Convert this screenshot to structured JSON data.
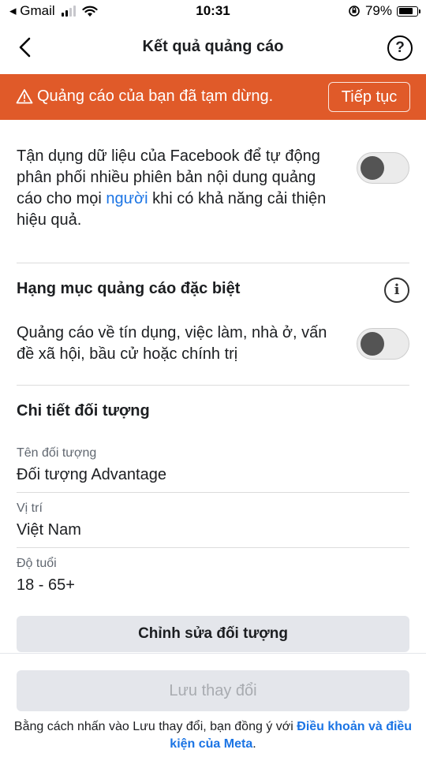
{
  "status_bar": {
    "carrier": "◂ Gmail",
    "time": "10:31",
    "battery": "79%"
  },
  "header": {
    "title": "Kết quả quảng cáo",
    "help_label": "?"
  },
  "banner": {
    "message": "Quảng cáo của bạn đã tạm dừng.",
    "action_label": "Tiếp tục",
    "color": "#e05a29"
  },
  "dynamic_creative": {
    "text_before_link": "Tận dụng dữ liệu của Facebook để tự động phân phối nhiều phiên bản nội dung quảng cáo cho mọi ",
    "link_text": "người",
    "text_after_link": " khi có khả năng cải thiện hiệu quả.",
    "enabled": false
  },
  "special_category": {
    "title": "Hạng mục quảng cáo đặc biệt",
    "description": "Quảng cáo về tín dụng, việc làm, nhà ở, vấn đề xã hội, bầu cử hoặc chính trị",
    "enabled": false
  },
  "audience": {
    "title": "Chi tiết đối tượng",
    "fields": [
      {
        "label": "Tên đối tượng",
        "value": "Đối tượng Advantage"
      },
      {
        "label": "Vị trí",
        "value": "Việt Nam"
      },
      {
        "label": "Độ tuổi",
        "value": "18 - 65+"
      }
    ],
    "edit_label": "Chỉnh sửa đối tượng"
  },
  "footer": {
    "save_label": "Lưu thay đổi",
    "terms_text": "Bằng cách nhấn vào Lưu thay đổi, bạn đồng ý với ",
    "terms_link": "Điều khoản và điều kiện của Meta",
    "terms_end": "."
  },
  "colors": {
    "accent_link": "#1b74e4",
    "banner": "#e05a29"
  }
}
